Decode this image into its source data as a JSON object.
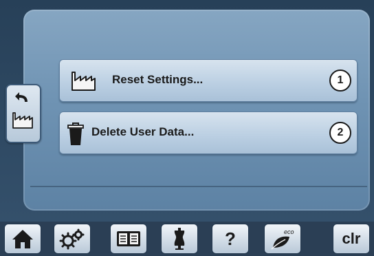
{
  "menu": {
    "items": [
      {
        "label": "Reset Settings...",
        "badge": "1",
        "icon": "factory-icon"
      },
      {
        "label": "Delete User Data...",
        "badge": "2",
        "icon": "trash-icon"
      }
    ]
  },
  "side_tab": {
    "icons": [
      "back-arrow-icon",
      "factory-icon"
    ]
  },
  "toolbar": {
    "home_icon": "home-icon",
    "settings_icon": "gears-icon",
    "tutorial_icon": "book-icon",
    "advisor_icon": "dress-form-icon",
    "help_label": "?",
    "eco_label": "eco",
    "clr_label": "clr"
  },
  "colors": {
    "panel": "#7a9cbb",
    "background": "#2b3f55",
    "button": "#c7d7e6"
  }
}
